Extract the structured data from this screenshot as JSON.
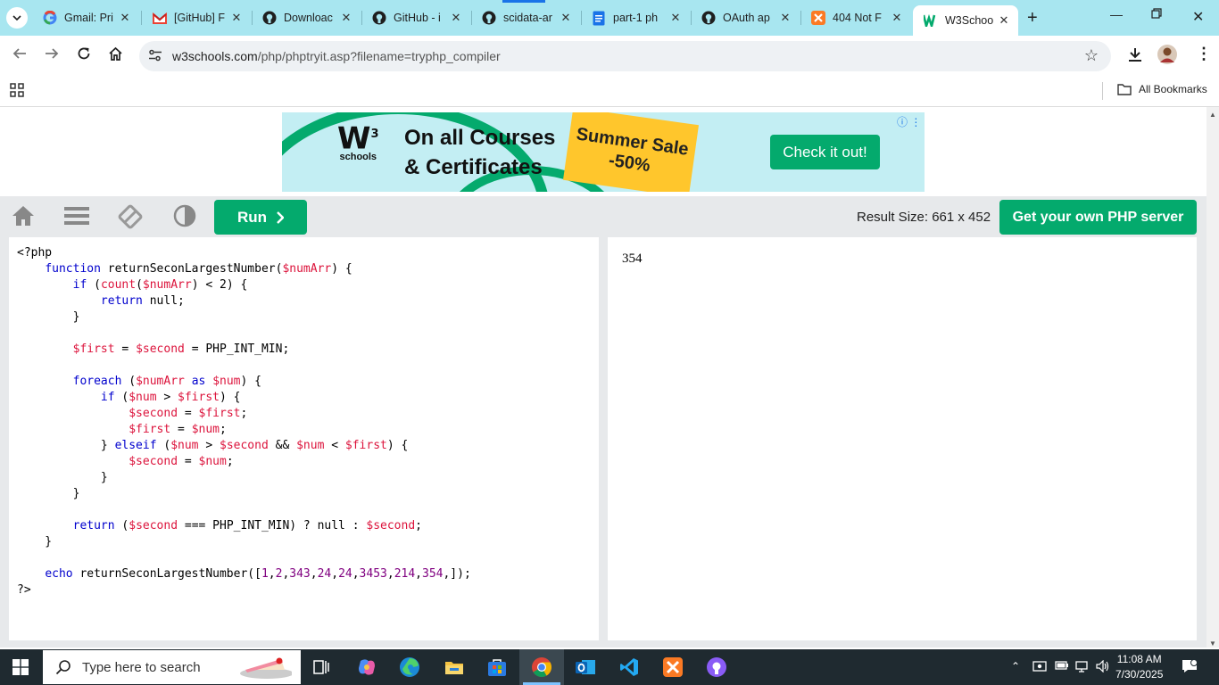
{
  "browser": {
    "tabs": [
      {
        "title": "Gmail: Pri",
        "icon": "google-icon"
      },
      {
        "title": "[GitHub] F",
        "icon": "gmail-icon"
      },
      {
        "title": "Downloac",
        "icon": "github-icon"
      },
      {
        "title": "GitHub - i",
        "icon": "github-icon"
      },
      {
        "title": "scidata-ar",
        "icon": "github-icon"
      },
      {
        "title": "part-1 ph",
        "icon": "docs-icon"
      },
      {
        "title": "OAuth ap",
        "icon": "github-icon"
      },
      {
        "title": "404 Not F",
        "icon": "xampp-icon"
      },
      {
        "title": "W3Schoo",
        "icon": "w3schools-icon",
        "active": true
      }
    ],
    "url_host": "w3schools.com",
    "url_path": "/php/phptryit.asp?filename=tryphp_compiler",
    "bookmarks_label": "All Bookmarks"
  },
  "ad": {
    "logo_text": "schools",
    "headline_line1": "On all Courses",
    "headline_line2": "& Certificates",
    "sale_line1": "Summer Sale",
    "sale_line2": "-50%",
    "cta": "Check it out!"
  },
  "editor": {
    "run_label": "Run",
    "result_size": "Result Size: 661 x 452",
    "server_button": "Get your own PHP server",
    "code_lines": [
      "<?php",
      "    function returnSeconLargestNumber($numArr) {",
      "        if (count($numArr) < 2) {",
      "            return null;",
      "        }",
      "",
      "        $first = $second = PHP_INT_MIN;",
      "",
      "        foreach ($numArr as $num) {",
      "            if ($num > $first) {",
      "                $second = $first;",
      "                $first = $num;",
      "            } elseif ($num > $second && $num < $first) {",
      "                $second = $num;",
      "            }",
      "        }",
      "",
      "        return ($second === PHP_INT_MIN) ? null : $second;",
      "    }",
      "",
      "    echo returnSeconLargestNumber([1,2,343,24,24,3453,214,354,]);",
      "?>"
    ],
    "output": "354"
  },
  "taskbar": {
    "search_placeholder": "Type here to search",
    "time": "11:08 AM",
    "date": "7/30/2025"
  },
  "colors": {
    "accent_green": "#04aa6d",
    "tabstrip": "#a8e6f0",
    "taskbar": "#1f2a30"
  }
}
